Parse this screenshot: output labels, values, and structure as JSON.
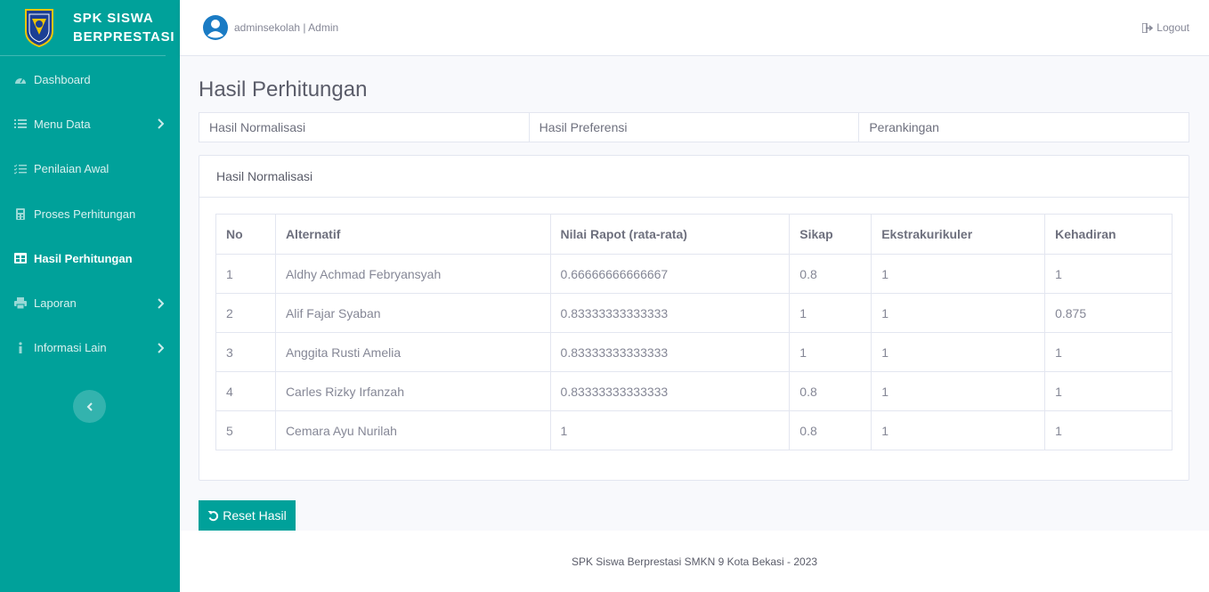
{
  "brand": {
    "line1": "SPK SISWA",
    "line2": "BERPRESTASI"
  },
  "sidebar": {
    "items": [
      {
        "label": "Dashboard",
        "icon": "tachometer-icon",
        "has_chevron": false,
        "active": false
      },
      {
        "label": "Menu Data",
        "icon": "list-icon",
        "has_chevron": true,
        "active": false
      },
      {
        "label": "Penilaian Awal",
        "icon": "list-check-icon",
        "has_chevron": false,
        "active": false
      },
      {
        "label": "Proses Perhitungan",
        "icon": "calculator-icon",
        "has_chevron": false,
        "active": false
      },
      {
        "label": "Hasil Perhitungan",
        "icon": "table-icon",
        "has_chevron": false,
        "active": true
      },
      {
        "label": "Laporan",
        "icon": "print-icon",
        "has_chevron": true,
        "active": false
      },
      {
        "label": "Informasi Lain",
        "icon": "info-icon",
        "has_chevron": true,
        "active": false
      }
    ]
  },
  "topbar": {
    "user_label": "adminsekolah | Admin",
    "logout_label": "Logout"
  },
  "page": {
    "title": "Hasil Perhitungan"
  },
  "tabs": [
    "Hasil Normalisasi",
    "Hasil Preferensi",
    "Perankingan"
  ],
  "card": {
    "title": "Hasil Normalisasi",
    "columns": [
      "No",
      "Alternatif",
      "Nilai Rapot (rata-rata)",
      "Sikap",
      "Ekstrakurikuler",
      "Kehadiran"
    ],
    "rows": [
      [
        "1",
        "Aldhy Achmad Febryansyah",
        "0.66666666666667",
        "0.8",
        "1",
        "1"
      ],
      [
        "2",
        "Alif Fajar Syaban",
        "0.83333333333333",
        "1",
        "1",
        "0.875"
      ],
      [
        "3",
        "Anggita Rusti Amelia",
        "0.83333333333333",
        "1",
        "1",
        "1"
      ],
      [
        "4",
        "Carles Rizky Irfanzah",
        "0.83333333333333",
        "0.8",
        "1",
        "1"
      ],
      [
        "5",
        "Cemara Ayu Nurilah",
        "1",
        "0.8",
        "1",
        "1"
      ]
    ]
  },
  "reset_button": {
    "label": "Reset Hasil"
  },
  "footer": {
    "text": "SPK Siswa Berprestasi SMKN 9 Kota Bekasi - 2023"
  },
  "colors": {
    "primary": "#00a19a",
    "avatar": "#1a7bc4"
  }
}
